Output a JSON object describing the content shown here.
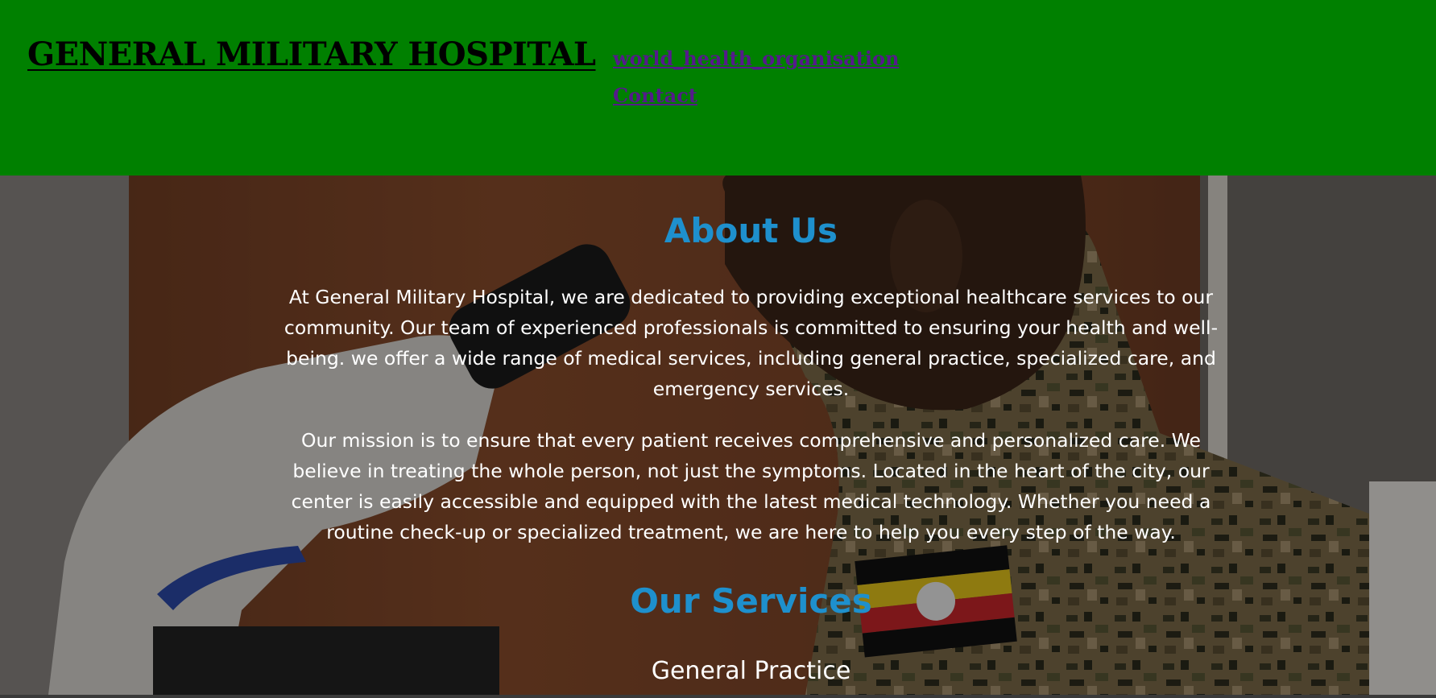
{
  "header": {
    "title": "GENERAL MILITARY HOSPITAL",
    "nav": [
      {
        "label": "world_health_organisation"
      },
      {
        "label": "Contact"
      }
    ],
    "background_color": "#008000",
    "link_color": "#551a8b"
  },
  "about": {
    "heading": "About Us",
    "paragraphs": [
      "At General Military Hospital, we are dedicated to providing exceptional healthcare services to our community. Our team of experienced professionals is committed to ensuring your health and well-being. we offer a wide range of medical services, including general practice, specialized care, and emergency services.",
      "Our mission is to ensure that every patient receives comprehensive and personalized care. We believe in treating the whole person, not just the symptoms. Located in the heart of the city, our center is easily accessible and equipped with the latest medical technology. Whether you need a routine check-up or specialized treatment, we are here to help you every step of the way."
    ]
  },
  "services": {
    "heading": "Our Services",
    "items": [
      "General Practice"
    ]
  },
  "colors": {
    "heading_accent": "#1e90cd",
    "body_text": "#ffffff"
  },
  "hero": {
    "image": "soldier-at-microscope-photo"
  }
}
